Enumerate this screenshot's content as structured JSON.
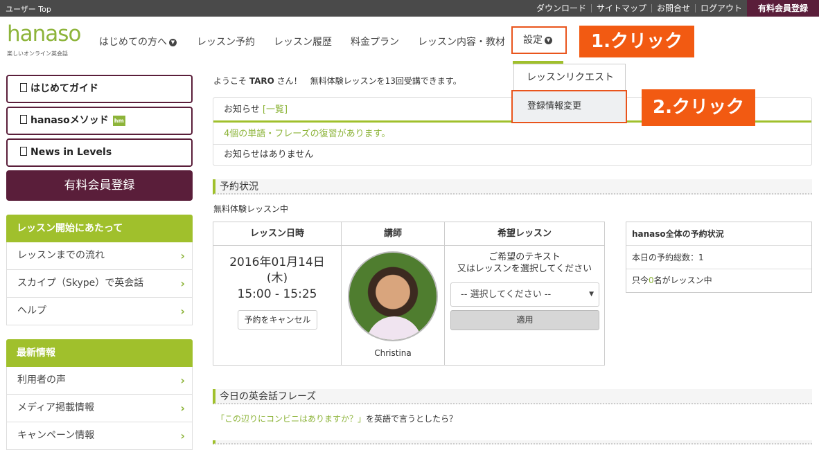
{
  "topbar": {
    "title": "ユーザー Top",
    "links": [
      "ダウンロード",
      "サイトマップ",
      "お問合せ",
      "ログアウト"
    ],
    "paid_signup": "有料会員登録"
  },
  "logo": {
    "word": "hanaso",
    "tagline": "楽しいオンライン英会話"
  },
  "nav": {
    "items": [
      "はじめての方へ",
      "レッスン予約",
      "レッスン履歴",
      "料金プラン",
      "レッスン内容・教材"
    ],
    "settings": "設定"
  },
  "callouts": {
    "step1": "1.クリック",
    "step2": "2.クリック"
  },
  "settings_menu": {
    "items": [
      "レッスンリクエスト",
      "登録情報変更"
    ]
  },
  "sidebar": {
    "guides": [
      "はじめてガイド",
      "hanasoメソッド",
      "News in Levels"
    ],
    "paid_button": "有料会員登録",
    "sec1": {
      "title": "レッスン開始にあたって",
      "items": [
        "レッスンまでの流れ",
        "スカイプ（Skype）で英会話",
        "ヘルプ"
      ]
    },
    "sec2": {
      "title": "最新情報",
      "items": [
        "利用者の声",
        "メディア掲載情報",
        "キャンペーン情報"
      ]
    }
  },
  "welcome": {
    "prefix": "ようこそ",
    "user": "TARO",
    "suffix": "さん！　無料体験レッスンを13回受講できます。"
  },
  "notice": {
    "title": "お知らせ",
    "link": "[一覧]",
    "review": "4個の単語・フレーズの復習があります。",
    "none": "お知らせはありません"
  },
  "reservation": {
    "section_title": "予約状況",
    "status": "無料体験レッスン中",
    "headers": [
      "レッスン日時",
      "講師",
      "希望レッスン"
    ],
    "date_line1": "2016年01月14日",
    "date_line2": "(木)",
    "time": "15:00 - 15:25",
    "cancel": "予約をキャンセル",
    "teacher": "Christina",
    "hope_line1": "ご希望のテキスト",
    "hope_line2": "又はレッスンを選択してください",
    "select_value": "-- 選択してください --",
    "apply": "適用"
  },
  "overall": {
    "title": "hanaso全体の予約状況",
    "today": "本日の予約総数：1",
    "now_prefix": "只今",
    "now_count": "0",
    "now_suffix": "名がレッスン中"
  },
  "phrase": {
    "section_title": "今日の英会話フレーズ",
    "question": "「この辺りにコンビニはありますか？」",
    "suffix": "を英語で言うとしたら？"
  },
  "colors": {
    "brand_green": "#a0c02c",
    "brand_plum": "#5a1e3a",
    "callout": "#f25a12"
  }
}
